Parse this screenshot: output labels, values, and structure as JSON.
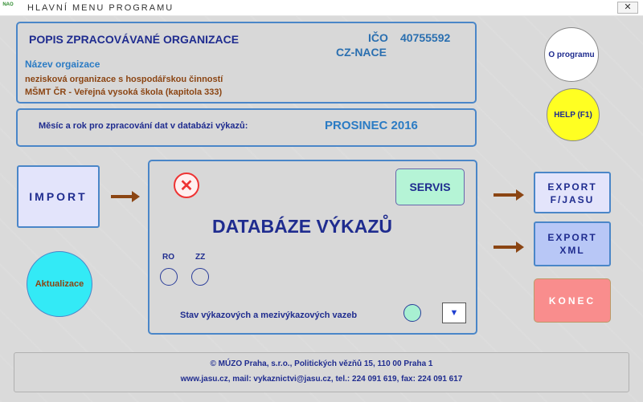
{
  "window": {
    "title": "HLAVNÍ MENU PROGRAMU",
    "close_glyph": "✕",
    "icon_text": "NAO"
  },
  "org": {
    "heading": "POPIS ZPRACOVÁVANÉ ORGANIZACE",
    "ico_label": "IČO",
    "ico_value": "40755592",
    "cznace_label": "CZ-NACE",
    "name_label": "Název orgaizace",
    "type": "nezisková organizace s hospodářskou činností",
    "ministry": "MŠMT ČR - Veřejná vysoká škola  (kapitola 333)"
  },
  "period": {
    "label": "Měsíc a rok pro zpracování dat v databázi  výkazů:",
    "value": "PROSINEC 2016"
  },
  "buttons": {
    "about": "O programu",
    "help": "HELP (F1)",
    "import": "IMPORT",
    "aktualizace": "Aktualizace",
    "servis": "SERVIS",
    "export_fjasu_line1": "EXPORT",
    "export_fjasu_line2": "F/JASU",
    "export_xml_line1": "EXPORT",
    "export_xml_line2": "XML",
    "konec": "KONEC"
  },
  "database": {
    "title": "DATABÁZE VÝKAZŮ",
    "ro_label": "RO",
    "zz_label": "ZZ",
    "stav_label": "Stav výkazových a mezivýkazových vazeb",
    "close_glyph": "✕",
    "scroll_glyph": "▼"
  },
  "footer": {
    "line1": "© MÚZO Praha, s.r.o.,  Politických vězňů 15,  110 00  Praha 1",
    "line2": "www.jasu.cz,  mail: vykaznictvi@jasu.cz,  tel.: 224 091 619,  fax: 224 091 617"
  },
  "icons": [
    "app-icon",
    "close-icon",
    "arrow-right-icon",
    "chevron-down-icon"
  ],
  "colors": {
    "accent": "#4a86c8",
    "text": "#1f2c8f",
    "help": "#ffff22",
    "konec": "#f98d8d",
    "servis": "#b5f4d6",
    "aktualizace": "#33eaf6"
  }
}
